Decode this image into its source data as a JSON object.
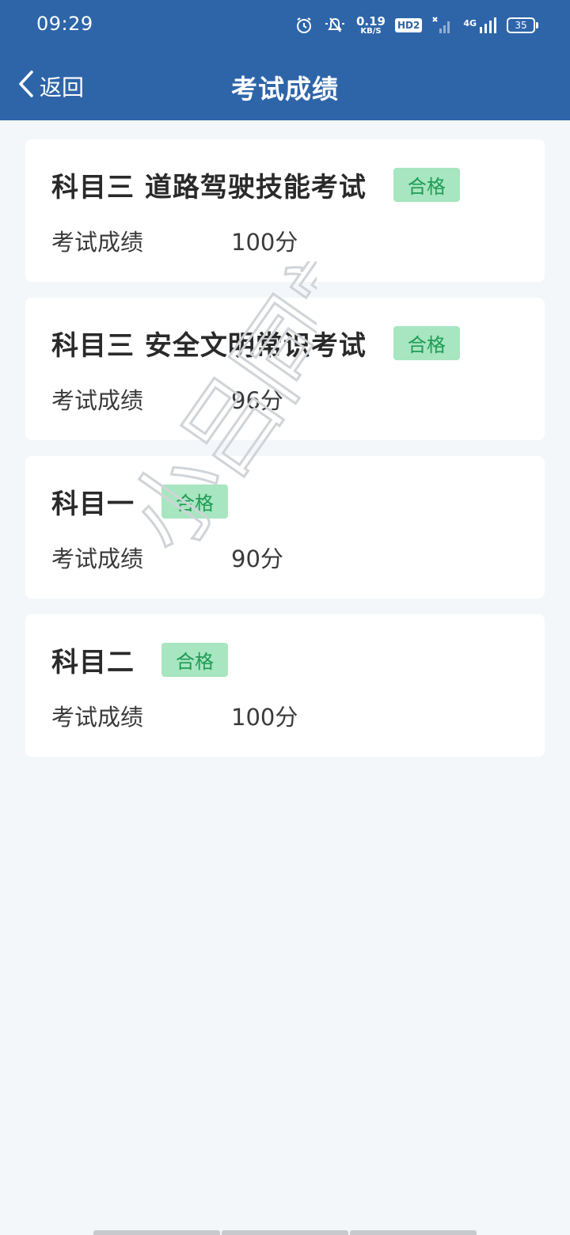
{
  "status": {
    "time": "09:29",
    "net_speed_value": "0.19",
    "net_speed_unit": "KB/S",
    "hd_label": "HD2",
    "network_type": "4G",
    "battery": "35"
  },
  "nav": {
    "back_label": "返回",
    "title": "考试成绩"
  },
  "results": [
    {
      "subject": "科目三 道路驾驶技能考试",
      "status": "合格",
      "score_label": "考试成绩",
      "score": "100分"
    },
    {
      "subject": "科目三 安全文明常识考试",
      "status": "合格",
      "score_label": "考试成绩",
      "score": "96分"
    },
    {
      "subject": "科目一",
      "status": "合格",
      "score_label": "考试成绩",
      "score": "90分"
    },
    {
      "subject": "科目二",
      "status": "合格",
      "score_label": "考试成绩",
      "score": "100分"
    }
  ],
  "colors": {
    "header_bg": "#2e65a9",
    "page_bg": "#f3f7f9",
    "badge_bg": "#a7e6c0",
    "badge_text": "#1f9b55"
  },
  "watermark": "小吕同学"
}
